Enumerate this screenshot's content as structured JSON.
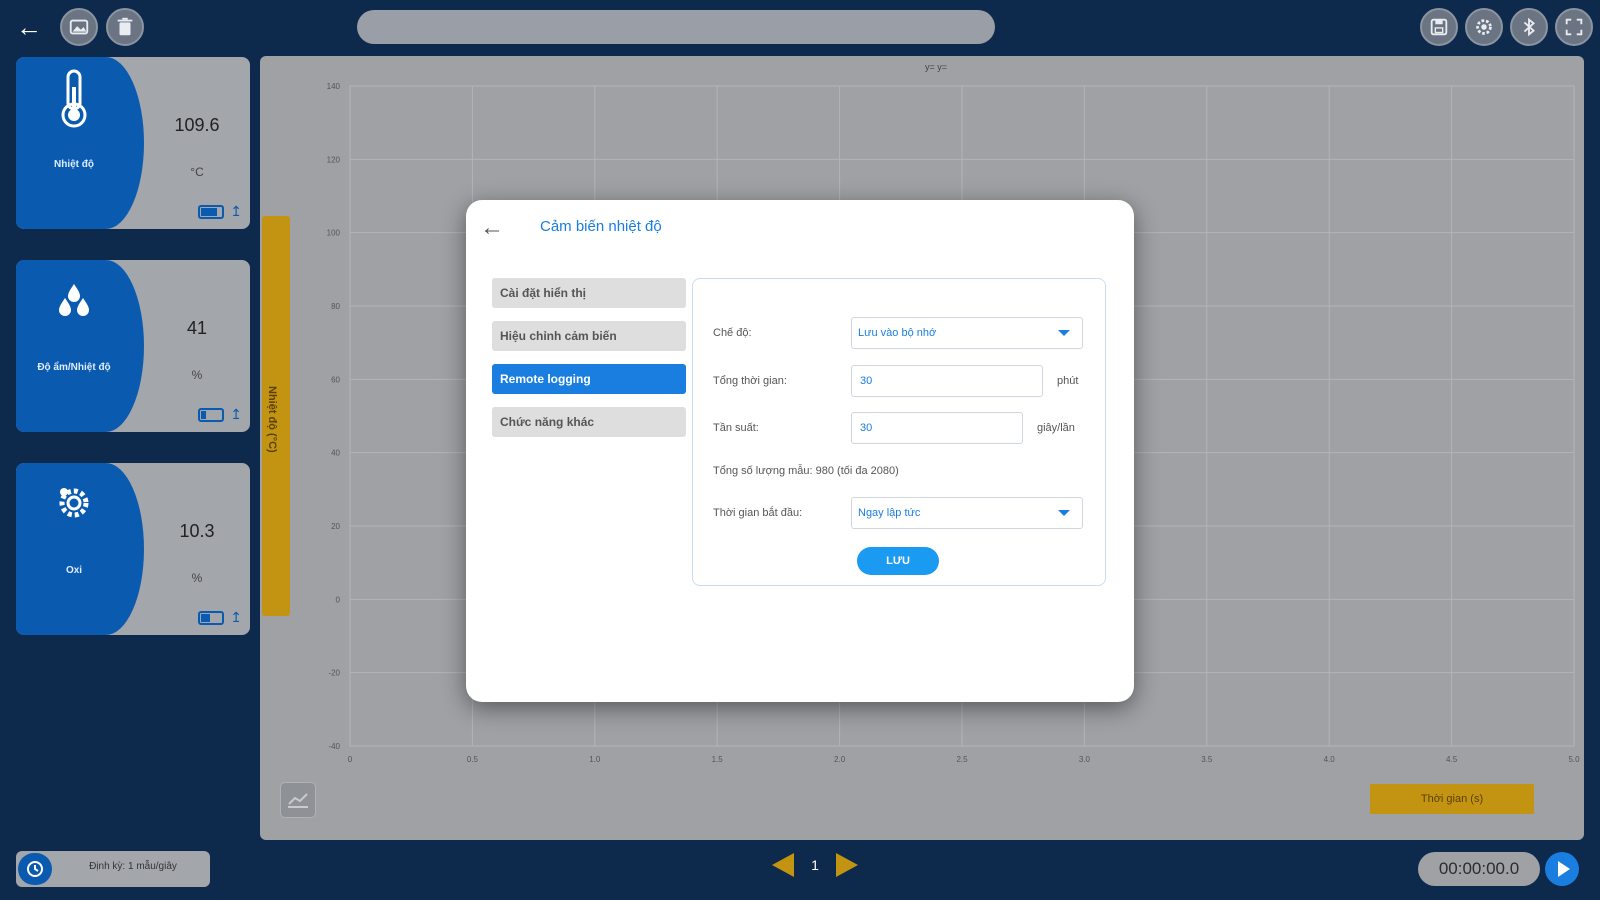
{
  "colors": {
    "accent": "#1a7ee0",
    "card_blue": "#0a5bb0",
    "axis_yellow": "#c39312",
    "background": "#0d2a4c"
  },
  "toolbar": {
    "back_icon": "arrow-left-icon",
    "left_icons": [
      "image-icon",
      "trash-icon"
    ],
    "right_icons": [
      "save-icon",
      "gear-icon",
      "bluetooth-icon",
      "fullscreen-icon"
    ],
    "title": ""
  },
  "sensors": [
    {
      "name": "Nhiệt độ",
      "value": "109.6",
      "unit": "°C",
      "icon": "thermometer-icon",
      "battery_level": 0.8
    },
    {
      "name": "Độ ẩm/Nhiệt độ",
      "value": "41",
      "unit": "%",
      "icon": "droplets-icon",
      "battery_level": 0.25
    },
    {
      "name": "Oxi",
      "value": "10.3",
      "unit": "%",
      "icon": "oxygen-gear-icon",
      "battery_level": 0.45
    }
  ],
  "chart": {
    "legend_text": "y= y=",
    "y_axis_label": "Nhiệt độ (°C)",
    "x_axis_label": "Thời gian (s)",
    "y_ticks": [
      "140",
      "120",
      "100",
      "80",
      "60",
      "40",
      "20",
      "0",
      "-20",
      "-40"
    ],
    "x_ticks": [
      "0",
      "0.5",
      "1.0",
      "1.5",
      "2.0",
      "2.5",
      "3.0",
      "3.5",
      "4.0",
      "4.5",
      "5.0"
    ],
    "tool_icon": "chart-line-icon"
  },
  "bottom": {
    "frequency_label": "Định kỳ: 1 mẫu/giây",
    "clock_icon": "clock-icon",
    "page_number": "1",
    "timer": "00:00:00.0",
    "play_icon": "play-icon"
  },
  "modal": {
    "title": "Cảm biến nhiệt độ",
    "back_icon": "arrow-left-icon",
    "menu": [
      {
        "label": "Cài đặt hiển thị",
        "active": false
      },
      {
        "label": "Hiệu chỉnh cảm biến",
        "active": false
      },
      {
        "label": "Remote logging",
        "active": true
      },
      {
        "label": "Chức năng khác",
        "active": false
      }
    ],
    "form": {
      "mode_label": "Chế độ:",
      "mode_value": "Lưu vào bộ nhớ",
      "total_time_label": "Tổng thời gian:",
      "total_time_value": "30",
      "total_time_unit": "phút",
      "frequency_label": "Tần suất:",
      "frequency_value": "30",
      "frequency_unit": "giây/lần",
      "sample_count_text": "Tổng số lượng mẫu: 980 (tối đa 2080)",
      "start_time_label": "Thời gian bắt đầu:",
      "start_time_value": "Ngay lập tức",
      "save_label": "LƯU"
    }
  }
}
